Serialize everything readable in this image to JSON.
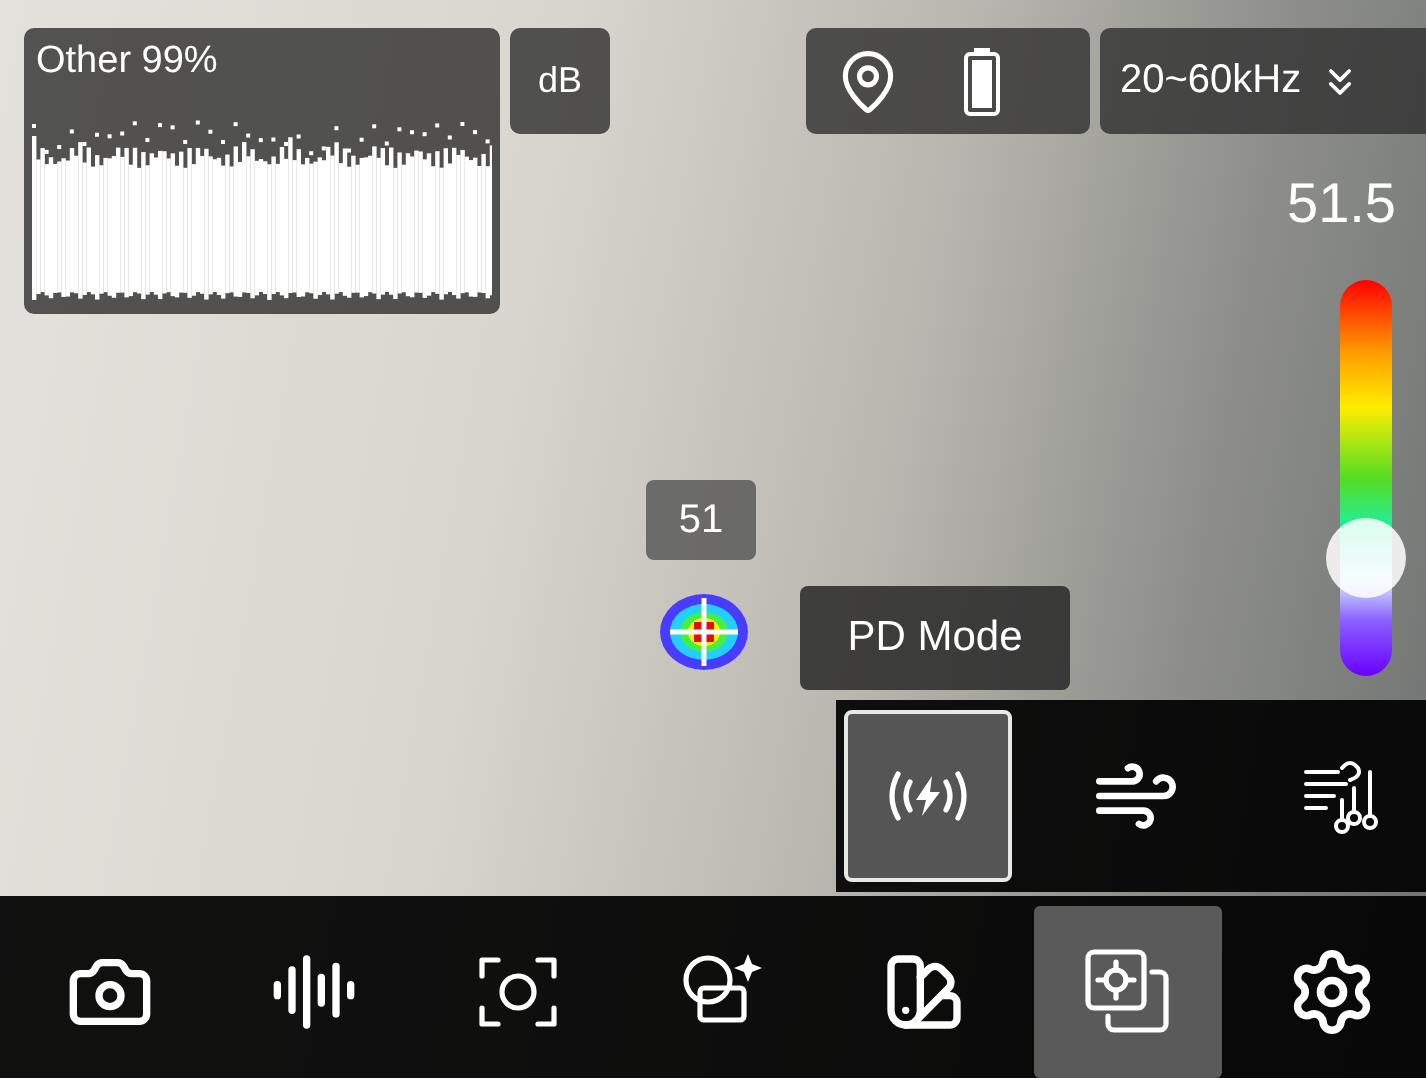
{
  "spectrum": {
    "label": "Other 99%"
  },
  "unit_button": {
    "label": "dB"
  },
  "frequency_dropdown": {
    "label": "20~60kHz"
  },
  "scale": {
    "max_reading": "51.5",
    "level": 0.3
  },
  "marker": {
    "reading": "51"
  },
  "mode_label": "PD Mode",
  "modes": [
    {
      "kind": "discharge",
      "selected": true
    },
    {
      "kind": "leak",
      "selected": false
    },
    {
      "kind": "mechanical",
      "selected": false
    }
  ],
  "toolbar": [
    {
      "kind": "camera",
      "selected": false
    },
    {
      "kind": "audio",
      "selected": false
    },
    {
      "kind": "focus",
      "selected": false
    },
    {
      "kind": "overlay",
      "selected": false
    },
    {
      "kind": "palette",
      "selected": false
    },
    {
      "kind": "layers",
      "selected": true
    },
    {
      "kind": "settings",
      "selected": false
    }
  ]
}
